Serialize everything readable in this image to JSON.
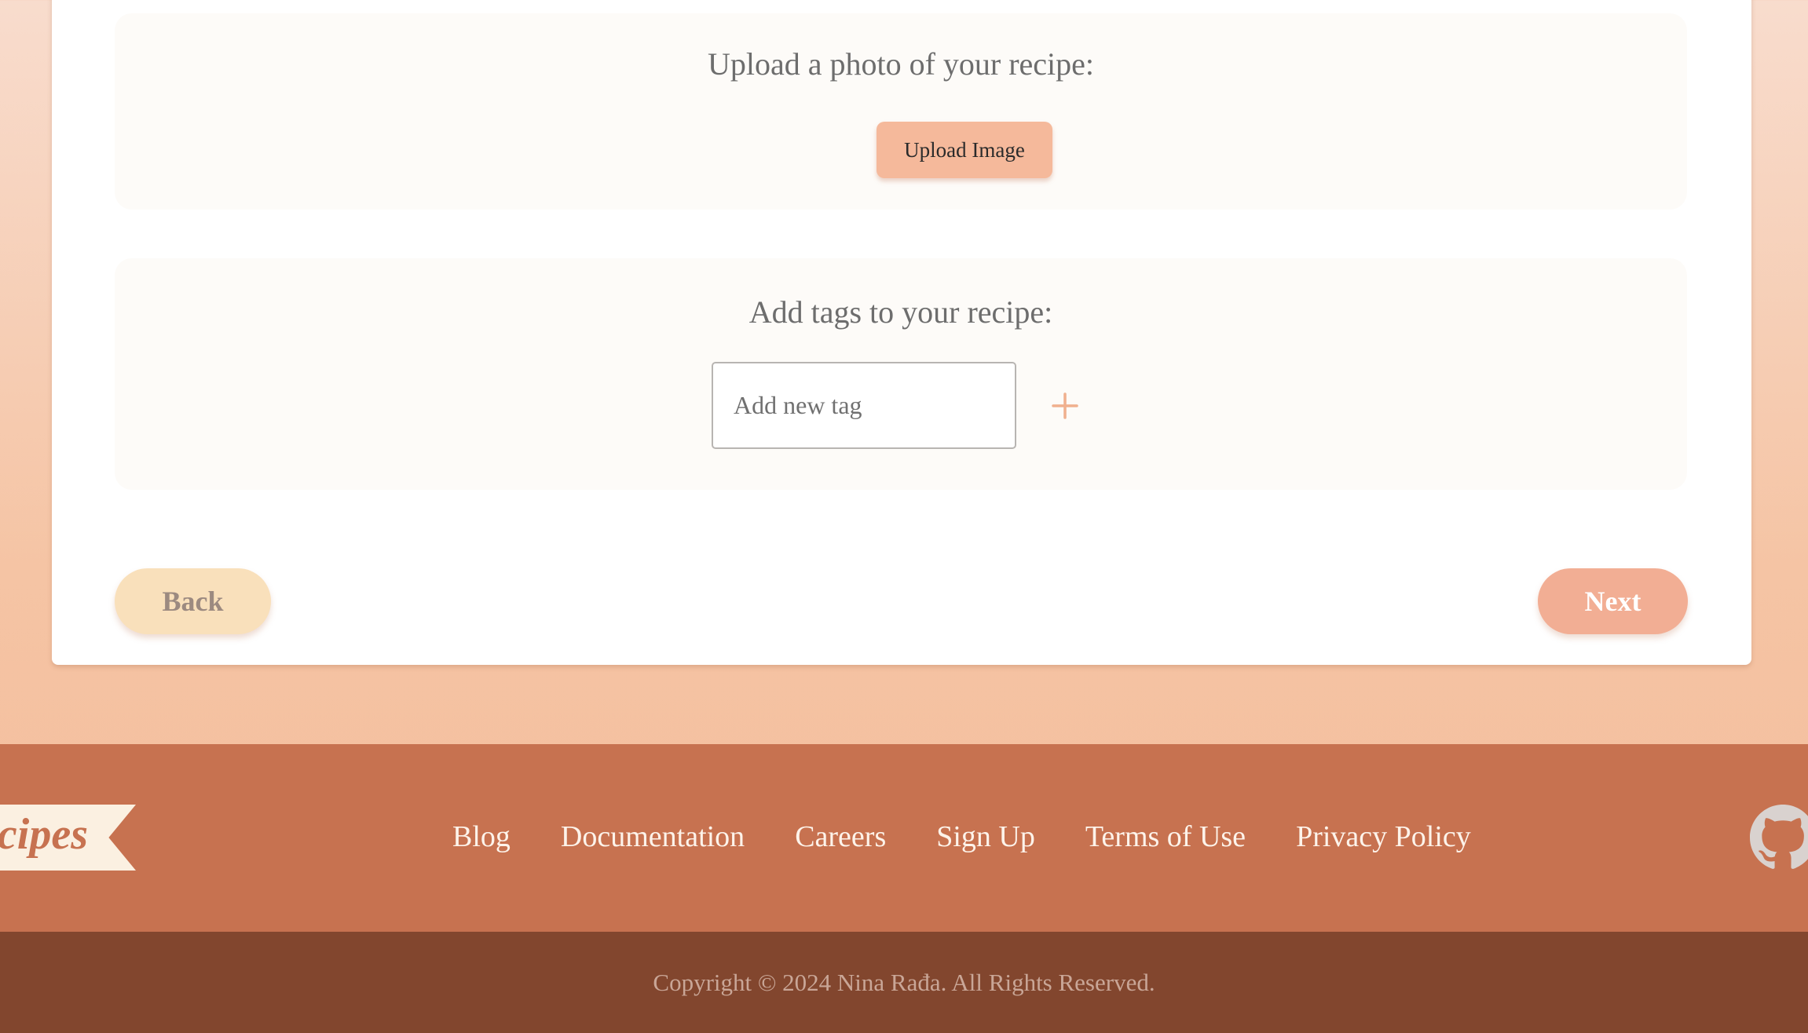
{
  "upload_section": {
    "title": "Upload a photo of your recipe:",
    "button_label": "Upload Image"
  },
  "tags_section": {
    "title": "Add tags to your recipe:",
    "input_placeholder": "Add new tag",
    "input_value": "",
    "add_icon": "plus-icon"
  },
  "navigation": {
    "back_label": "Back",
    "next_label": "Next"
  },
  "footer": {
    "brand_text": "Recipes",
    "links": [
      "Blog",
      "Documentation",
      "Careers",
      "Sign Up",
      "Terms of Use",
      "Privacy Policy"
    ],
    "social_icon": "github-icon",
    "copyright": "Copyright © 2024 Nina Rađa. All Rights Reserved."
  },
  "colors": {
    "accent": "#f5b99b",
    "back_button": "#f9e0bb",
    "next_button": "#f2ae94",
    "footer": "#c77250",
    "copyright_bar": "#82462e"
  }
}
